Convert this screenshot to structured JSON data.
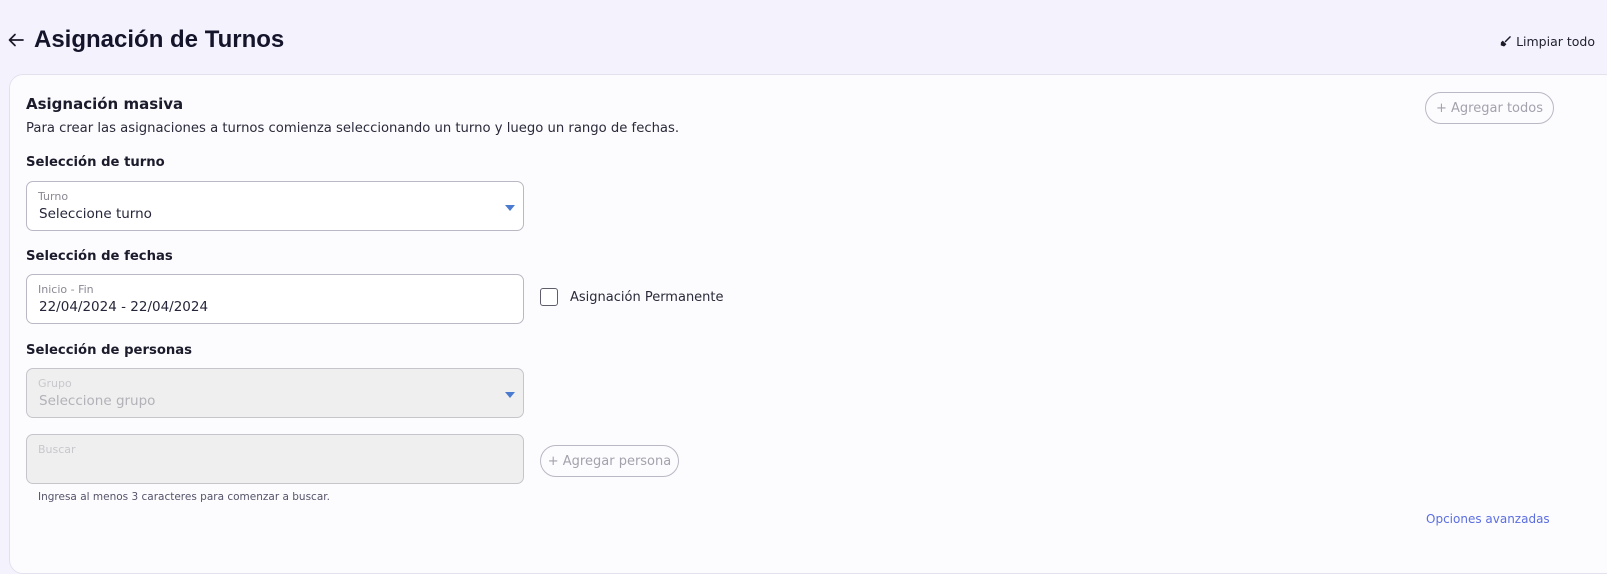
{
  "header": {
    "title": "Asignación de Turnos",
    "clear_label": "Limpiar todo"
  },
  "bulk": {
    "title": "Asignación masiva",
    "description": "Para crear las asignaciones a turnos comienza seleccionando un turno y luego un rango de fechas.",
    "add_all_label": "+ Agregar todos",
    "shift_section_title": "Selección de turno",
    "shift_field": {
      "label": "Turno",
      "value": "Seleccione turno"
    },
    "dates_section_title": "Selección de fechas",
    "dates_field": {
      "label": "Inicio - Fin",
      "value": "22/04/2024 - 22/04/2024"
    },
    "permanent_label": "Asignación Permanente",
    "permanent_checked": false,
    "people_section_title": "Selección de personas",
    "group_field": {
      "label": "Grupo",
      "value": "Seleccione grupo"
    },
    "search_field": {
      "label": "Buscar",
      "value": ""
    },
    "add_person_label": "+ Agregar persona",
    "search_helper": "Ingresa al menos 3 caracteres para comenzar a buscar.",
    "advanced_link": "Opciones avanzadas"
  },
  "colors": {
    "accent": "#5b6ee1",
    "page_background": "#f4f3fd",
    "dropdown_arrow": "#4a7bd0"
  }
}
